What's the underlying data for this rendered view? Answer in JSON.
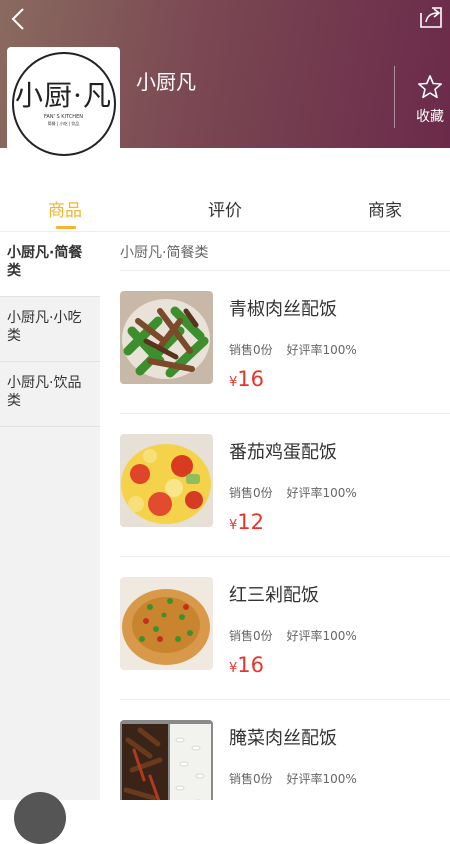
{
  "header": {
    "shop_name": "小厨凡",
    "logo": {
      "main": "小厨·凡",
      "sub": "FAN' S KITCHEN",
      "tagline": "简餐 | 小吃 | 饮品"
    },
    "favorite_label": "收藏"
  },
  "tabs": [
    {
      "label": "商品",
      "active": true
    },
    {
      "label": "评价",
      "active": false
    },
    {
      "label": "商家",
      "active": false
    }
  ],
  "sidebar": {
    "categories": [
      {
        "label": "小厨凡·简餐类",
        "active": true
      },
      {
        "label": "小厨凡·小吃类",
        "active": false
      },
      {
        "label": "小厨凡·饮品类",
        "active": false
      }
    ]
  },
  "menu": {
    "section_title": "小厨凡·简餐类",
    "items": [
      {
        "name": "青椒肉丝配饭",
        "sales": "销售0份",
        "rating": "好评率100%",
        "currency": "¥",
        "price": "16"
      },
      {
        "name": "番茄鸡蛋配饭",
        "sales": "销售0份",
        "rating": "好评率100%",
        "currency": "¥",
        "price": "12"
      },
      {
        "name": "红三剁配饭",
        "sales": "销售0份",
        "rating": "好评率100%",
        "currency": "¥",
        "price": "16"
      },
      {
        "name": "腌菜肉丝配饭",
        "sales": "销售0份",
        "rating": "好评率100%",
        "currency": "¥",
        "price": ""
      }
    ]
  },
  "colors": {
    "accent": "#f2b632",
    "price": "#e8352a",
    "header_start": "#8a6a60",
    "header_end": "#6b2a4a"
  }
}
